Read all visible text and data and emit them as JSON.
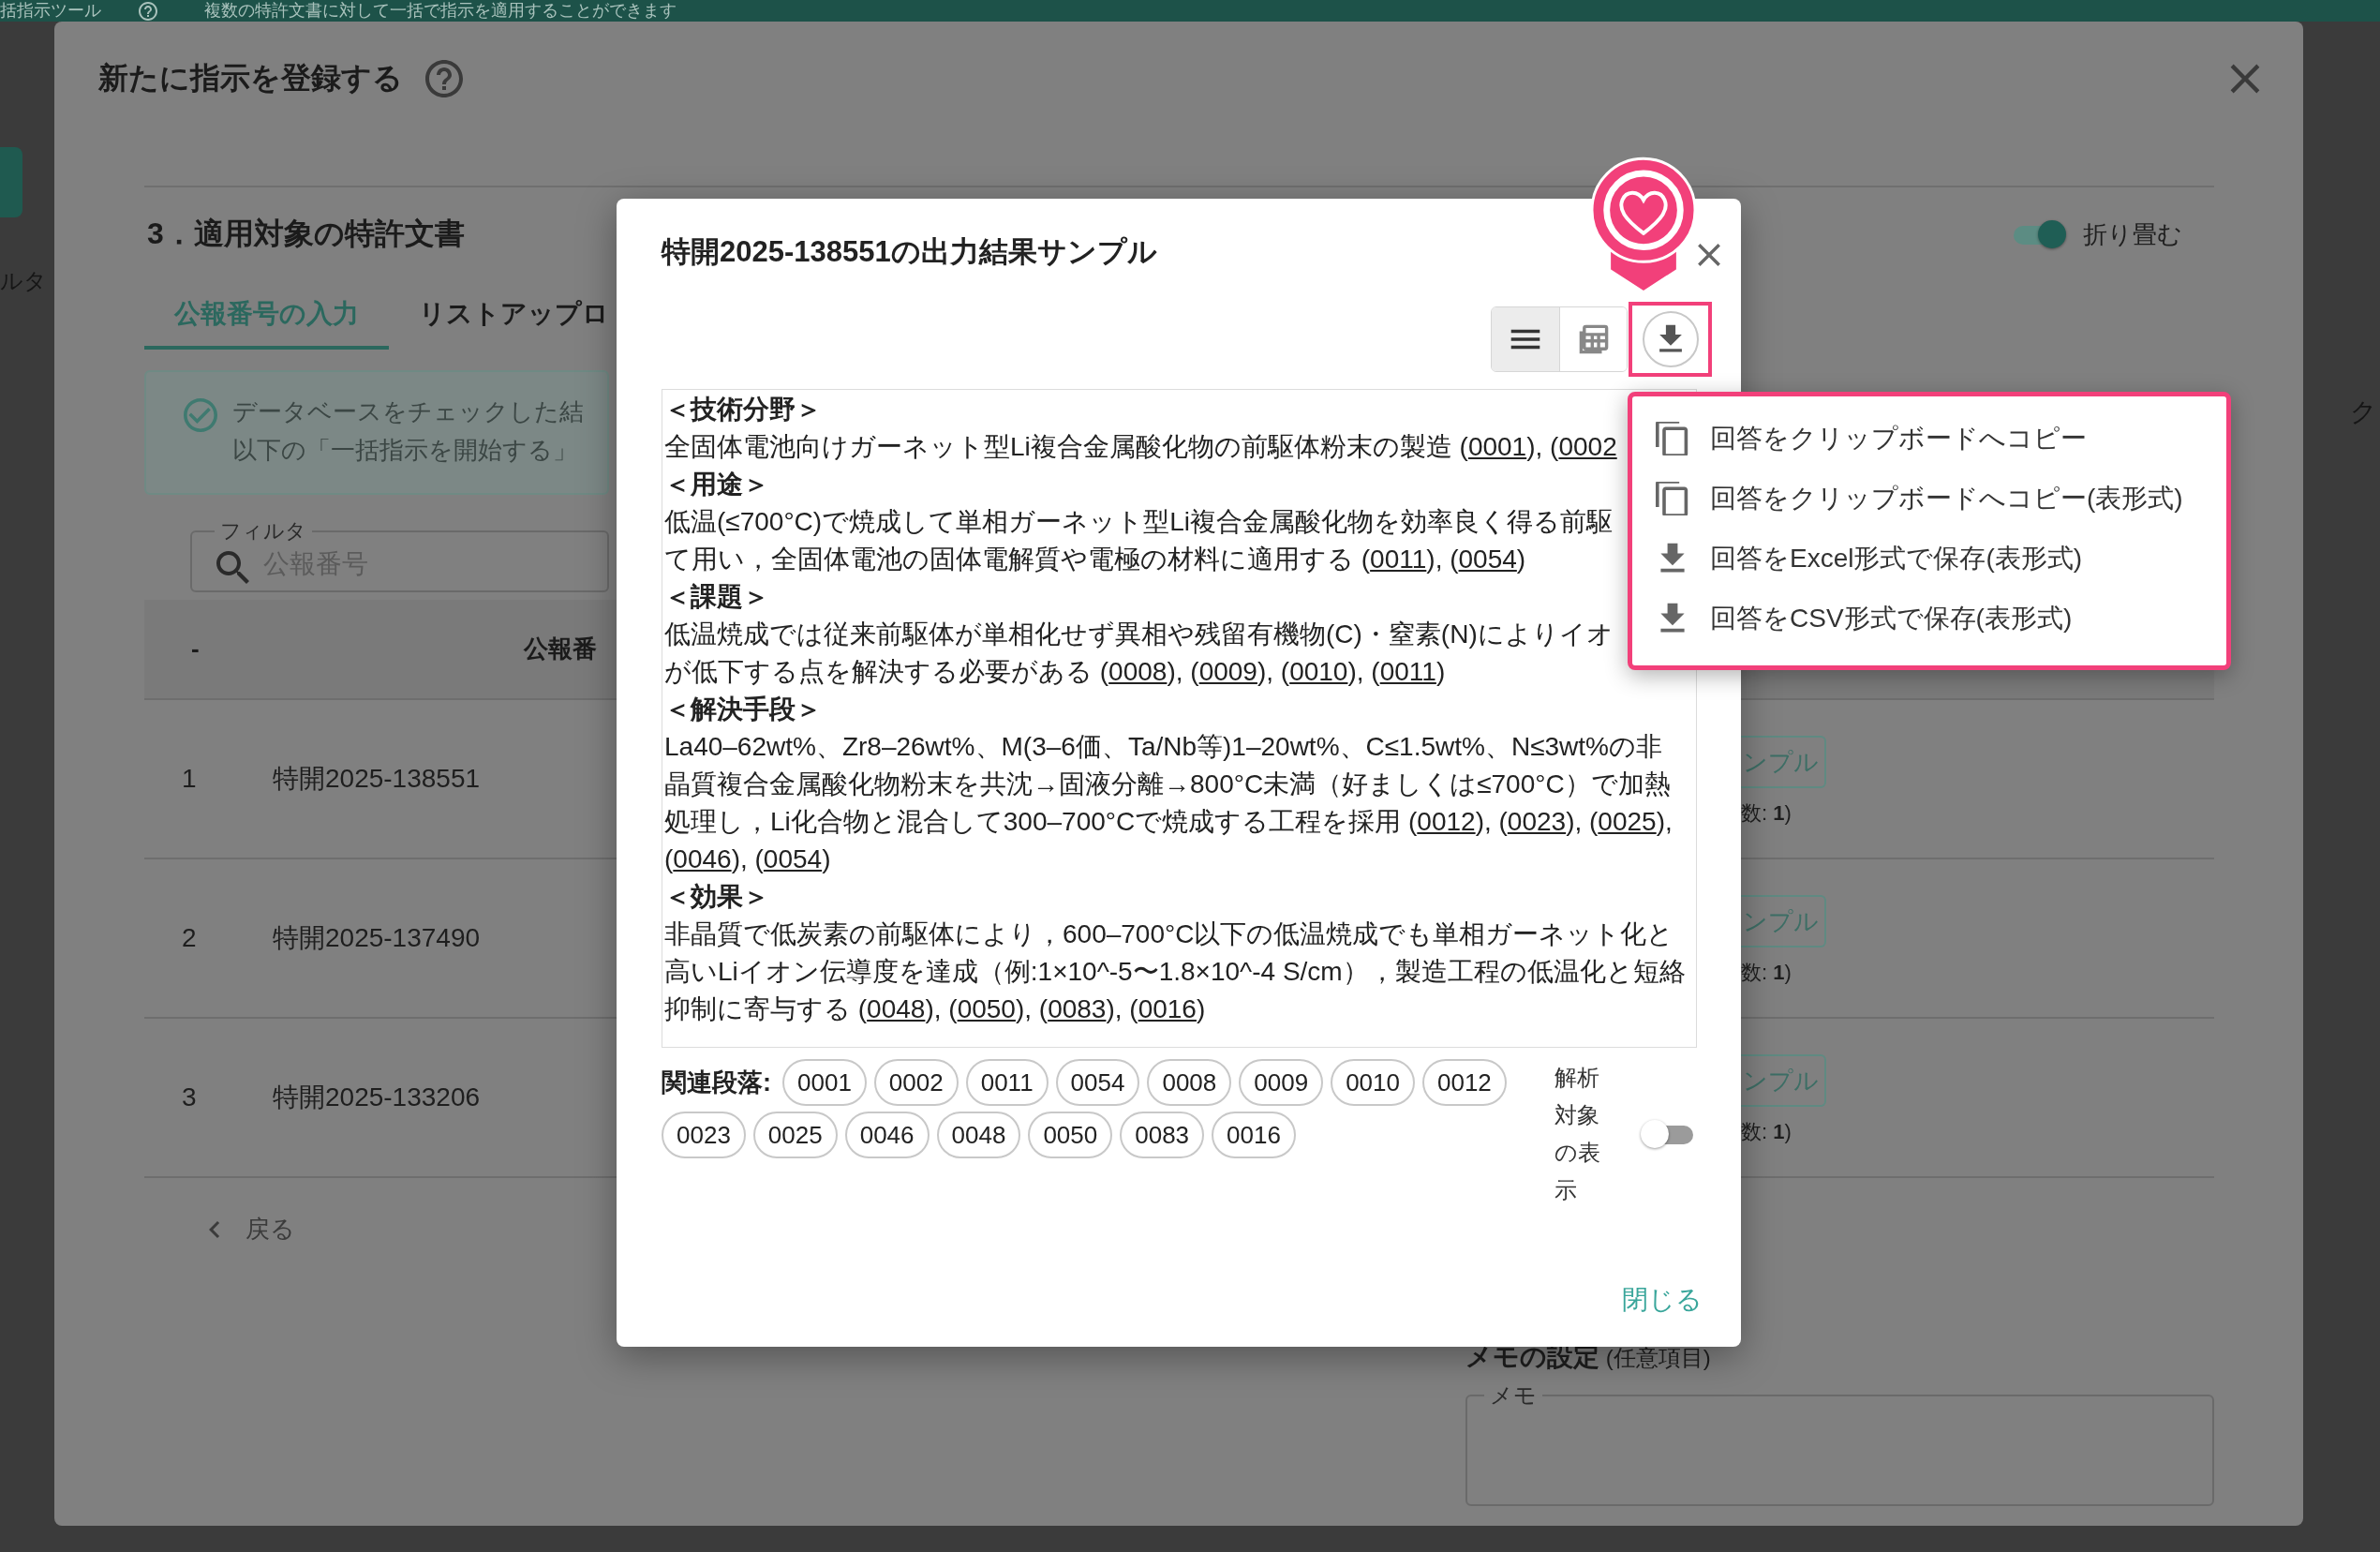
{
  "app_header": {
    "title": "括指示ツール",
    "subtitle": "複数の特許文書に対して一括で指示を適用することができます"
  },
  "background_fragments": {
    "left_label": "ルタ",
    "right_label": "ク"
  },
  "dialog": {
    "title": "新たに指示を登録する",
    "section_title": "3．適用対象の特許文書",
    "collapse_toggle": {
      "label": "折り畳む",
      "on": true
    },
    "tabs": [
      {
        "label": "公報番号の入力",
        "selected": true
      },
      {
        "label": "リストアップロ",
        "selected": false
      }
    ],
    "info_lines": [
      "データベースをチェックした結",
      "以下の「一括指示を開始する」"
    ],
    "filter": {
      "label": "フィルタ",
      "placeholder": "公報番号"
    },
    "table": {
      "columns": [
        "-",
        "公報番"
      ],
      "rows": [
        {
          "index": "1",
          "number": "特開2025-138551",
          "button": "ンプル",
          "note": "数: **1**)"
        },
        {
          "index": "2",
          "number": "特開2025-137490",
          "button": "ンプル",
          "note": "数: **1**)"
        },
        {
          "index": "3",
          "number": "特開2025-133206",
          "button": "ンプル",
          "note": "数: **1**)"
        }
      ]
    },
    "back_link": "戻る",
    "memo": {
      "title": "**メモの設定** (任意項目)",
      "label": "メモ"
    }
  },
  "result_modal": {
    "title": "特開2025-138551の出力結果サンプル",
    "view_modes": [
      {
        "kind": "text",
        "selected": true
      },
      {
        "kind": "table",
        "selected": false
      }
    ],
    "download_button": {
      "highlighted": true
    },
    "sections": [
      {
        "heading": "＜技術分野＞",
        "lines": [
          [
            {
              "kind": "text",
              "text": "全固体電池向けガーネット型Li複合金属酸化物の前駆体粉末の製造 ("
            },
            {
              "kind": "ref",
              "text": "0001"
            },
            {
              "kind": "text",
              "text": "), ("
            },
            {
              "kind": "ref",
              "text": "0002"
            }
          ]
        ]
      },
      {
        "heading": "＜用途＞",
        "lines": [
          [
            {
              "kind": "text",
              "text": "低温(≤700°C)で焼成して単相ガーネット型Li複合金属酸化物を効率良く得る前駆"
            }
          ],
          [
            {
              "kind": "text",
              "text": "て用い，全固体電池の固体電解質や電極の材料に適用する ("
            },
            {
              "kind": "ref",
              "text": "0011"
            },
            {
              "kind": "text",
              "text": "), ("
            },
            {
              "kind": "ref",
              "text": "0054"
            },
            {
              "kind": "text",
              "text": ")"
            }
          ]
        ]
      },
      {
        "heading": "＜課題＞",
        "lines": [
          [
            {
              "kind": "text",
              "text": "低温焼成では従来前駆体が単相化せず異相や残留有機物(C)・窒素(N)によりイオ"
            }
          ],
          [
            {
              "kind": "text",
              "text": "が低下する点を解決する必要がある ("
            },
            {
              "kind": "ref",
              "text": "0008"
            },
            {
              "kind": "text",
              "text": "), ("
            },
            {
              "kind": "ref",
              "text": "0009"
            },
            {
              "kind": "text",
              "text": "), ("
            },
            {
              "kind": "ref",
              "text": "0010"
            },
            {
              "kind": "text",
              "text": "), ("
            },
            {
              "kind": "ref",
              "text": "0011"
            },
            {
              "kind": "text",
              "text": ")"
            }
          ]
        ]
      },
      {
        "heading": "＜解決手段＞",
        "lines": [
          [
            {
              "kind": "text",
              "text": "La40–62wt%、Zr8–26wt%、M(3–6価、Ta/Nb等)1–20wt%、C≤1.5wt%、N≤3wt%の非"
            }
          ],
          [
            {
              "kind": "text",
              "text": "晶質複合金属酸化物粉末を共沈→固液分離→800°C未満（好ましくは≤700°C）で加熱"
            }
          ],
          [
            {
              "kind": "text",
              "text": "処理し，Li化合物と混合して300–700°Cで焼成する工程を採用 ("
            },
            {
              "kind": "ref",
              "text": "0012"
            },
            {
              "kind": "text",
              "text": "), ("
            },
            {
              "kind": "ref",
              "text": "0023"
            },
            {
              "kind": "text",
              "text": "), ("
            },
            {
              "kind": "ref",
              "text": "0025"
            },
            {
              "kind": "text",
              "text": "),"
            }
          ],
          [
            {
              "kind": "text",
              "text": "("
            },
            {
              "kind": "ref",
              "text": "0046"
            },
            {
              "kind": "text",
              "text": "), ("
            },
            {
              "kind": "ref",
              "text": "0054"
            },
            {
              "kind": "text",
              "text": ")"
            }
          ]
        ]
      },
      {
        "heading": "＜効果＞",
        "lines": [
          [
            {
              "kind": "text",
              "text": "非晶質で低炭素の前駆体により，600–700°C以下の低温焼成でも単相ガーネット化と"
            }
          ],
          [
            {
              "kind": "text",
              "text": "高いLiイオン伝導度を達成（例:1×10^-5〜1.8×10^-4 S/cm），製造工程の低温化と短絡"
            }
          ],
          [
            {
              "kind": "text",
              "text": "抑制に寄与する ("
            },
            {
              "kind": "ref",
              "text": "0048"
            },
            {
              "kind": "text",
              "text": "), ("
            },
            {
              "kind": "ref",
              "text": "0050"
            },
            {
              "kind": "text",
              "text": "), ("
            },
            {
              "kind": "ref",
              "text": "0083"
            },
            {
              "kind": "text",
              "text": "), ("
            },
            {
              "kind": "ref",
              "text": "0016"
            },
            {
              "kind": "text",
              "text": ")"
            }
          ]
        ]
      }
    ],
    "related_label": "関連段落:",
    "related_paragraphs": [
      "0001",
      "0002",
      "0011",
      "0054",
      "0008",
      "0009",
      "0010",
      "0012",
      "0023",
      "0025",
      "0046",
      "0048",
      "0050",
      "0083",
      "0016"
    ],
    "analysis_toggle": {
      "label": "解析対象の表示",
      "on": false
    },
    "close_button": "閉じる"
  },
  "export_menu": {
    "highlighted": true,
    "items": [
      {
        "kind": "copy",
        "label": "回答をクリップボードへコピー"
      },
      {
        "kind": "copy",
        "label": "回答をクリップボードへコピー(表形式)"
      },
      {
        "kind": "download",
        "label": "回答をExcel形式で保存(表形式)"
      },
      {
        "kind": "download",
        "label": "回答をCSV形式で保存(表形式)"
      }
    ]
  }
}
